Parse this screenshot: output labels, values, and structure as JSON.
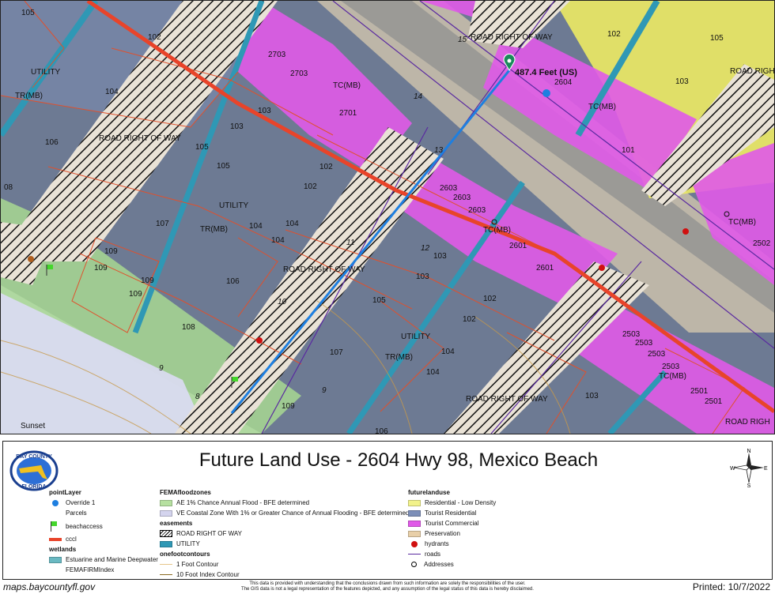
{
  "title": "Future Land Use - 2604 Hwy 98, Mexico Beach",
  "logo": {
    "county": "BAY COUNTY",
    "state": "FLORIDA"
  },
  "compass": {
    "n": "N",
    "s": "S",
    "e": "E",
    "w": "W"
  },
  "measurement": "487.4 Feet (US)",
  "map_labels": {
    "road_row": "ROAD RIGHT OF WAY",
    "road_row_trunc": "ROAD RIGH",
    "utility": "UTILITY",
    "trmb": "TR(MB)",
    "tcmb": "TC(MB)",
    "sunset": "Sunset",
    "n105": "105",
    "n102": "102",
    "n103": "103",
    "n104": "104",
    "n106": "106",
    "n107": "107",
    "n108": "108",
    "n109": "109",
    "n08": "08",
    "n101": "101",
    "n2703": "2703",
    "n2701": "2701",
    "n2604": "2604",
    "n2603": "2603",
    "n2601": "2601",
    "n2503": "2503",
    "n2501": "2501",
    "n2502": "2502",
    "r15": "15",
    "r14": "14",
    "r13": "13",
    "r12": "12",
    "r11": "11",
    "r10": "10",
    "r9": "9",
    "r8": "8"
  },
  "legend": {
    "pointLayer": {
      "heading": "pointLayer",
      "override": "Override 1",
      "parcels": "Parcels",
      "beachaccess": "beachaccess",
      "cccl": "cccl"
    },
    "wetlands": {
      "heading": "wetlands",
      "estuarine": "Estuarine and Marine Deepwater",
      "firm": "FEMAFIRMIndex"
    },
    "flood": {
      "heading": "FEMAfloodzones",
      "ae": "AE 1% Chance Annual Flood - BFE determined",
      "ve": "VE  Coastal Zone With 1% or Greater Chance of Annual Flooding - BFE determined"
    },
    "easements": {
      "heading": "easements",
      "row": "ROAD RIGHT OF WAY",
      "utility": "UTILITY"
    },
    "contours": {
      "heading": "onefootcontours",
      "one": "1 Foot Contour",
      "ten": "10 Foot Index Contour"
    },
    "flu": {
      "heading": "futurelanduse",
      "res_low": "Residential - Low Density",
      "tour_res": "Tourist Residential",
      "tour_com": "Tourist Commercial",
      "pres": "Preservation"
    },
    "hydrants": "hydrants",
    "roads": "roads",
    "addresses": "Addresses"
  },
  "colors": {
    "res_low": "#f2f28a",
    "tour_res": "#7d8fb8",
    "tour_com": "#e05ae8",
    "preservation": "#e8cfa8",
    "ae": "#b6e0a0",
    "ve": "#d4d4ee",
    "utility": "#2f98b5",
    "cccl": "#e8442a",
    "wet": "#6ab9c2",
    "hydrant": "#d01010",
    "override": "#1e7fe0"
  },
  "footer": {
    "url": "maps.baycountyfl.gov",
    "printed": "Printed: 10/7/2022",
    "disclaimer1": "This data is provided with understanding that the conclusions drawn from such information are solely the responsibilities of the user.",
    "disclaimer2": "The GIS data is not a legal representation of the features depicted, and any assumption of the legal status of this data is hereby disclaimed."
  }
}
